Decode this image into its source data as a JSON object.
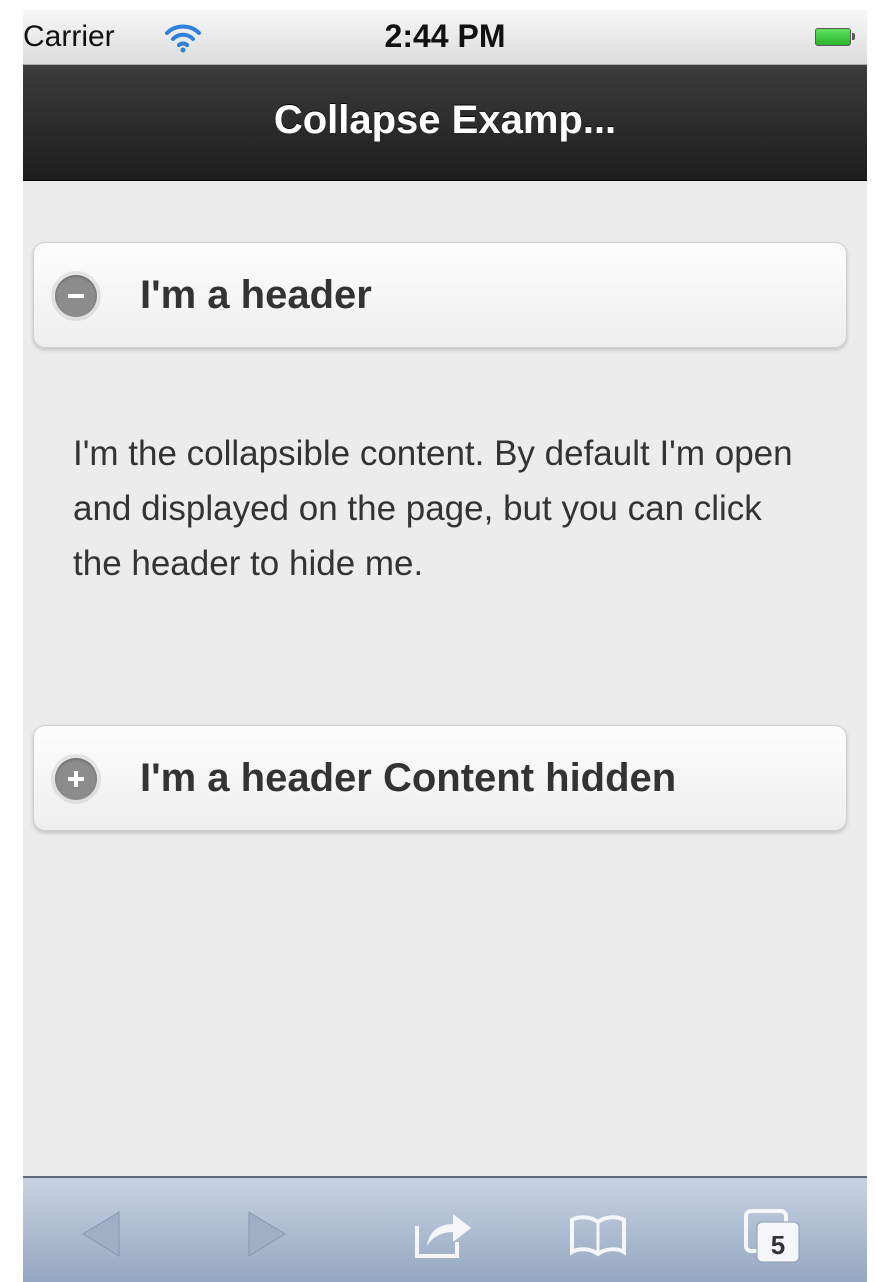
{
  "status_bar": {
    "carrier": "Carrier",
    "time": "2:44 PM",
    "wifi_icon": "wifi-icon",
    "battery_icon": "battery-icon",
    "battery_color": "#3cc93d"
  },
  "header": {
    "title": "Collapse Examp..."
  },
  "collapsibles": [
    {
      "header": "I'm a header",
      "icon": "minus-icon",
      "expanded": true,
      "content": "I'm the collapsible content. By default I'm open and displayed on the page, but you can click the header to hide me."
    },
    {
      "header": "I'm a header Content hidden",
      "icon": "plus-icon",
      "expanded": false
    }
  ],
  "toolbar": {
    "back_icon": "back-arrow-icon",
    "forward_icon": "forward-arrow-icon",
    "share_icon": "share-icon",
    "bookmarks_icon": "bookmarks-icon",
    "tabs_icon": "tabs-icon",
    "tabs_count": "5"
  },
  "colors": {
    "title_bar": "#1d1d1d",
    "toolbar": "#93a6c0",
    "page_background": "#ececec"
  }
}
